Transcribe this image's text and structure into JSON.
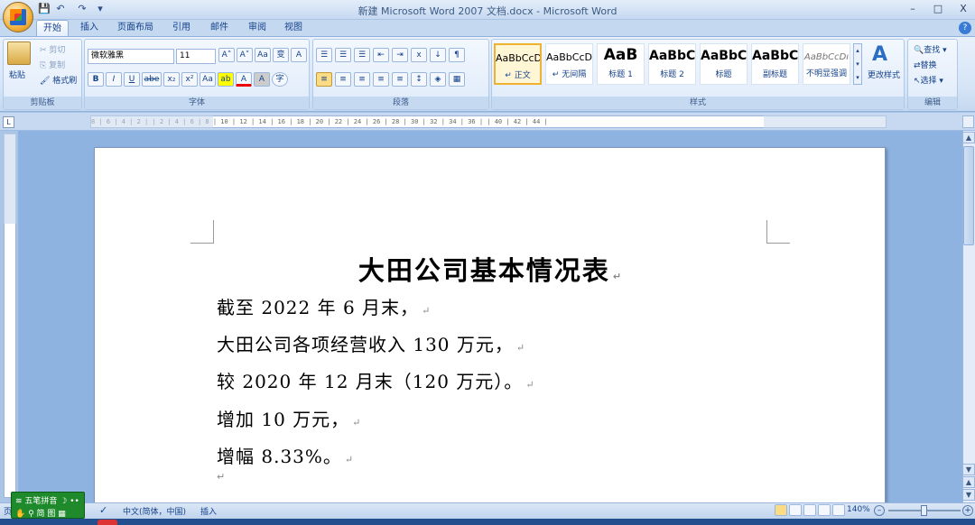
{
  "window": {
    "title": "新建 Microsoft Word 2007 文档.docx - Microsoft Word",
    "minimize": "–",
    "restore": "□",
    "close": "X"
  },
  "qat": {
    "save": "💾",
    "undo": "↶",
    "redo": "↷",
    "more": "▾"
  },
  "tabs": [
    "开始",
    "插入",
    "页面布局",
    "引用",
    "邮件",
    "审阅",
    "视图"
  ],
  "ribbon": {
    "clipboard": {
      "paste": "粘贴",
      "cut": "剪切",
      "copy": "复制",
      "format_painter": "格式刷",
      "label": "剪贴板"
    },
    "font": {
      "name": "微软雅黑",
      "size": "11",
      "label": "字体",
      "btns_row1": [
        "A˄",
        "A˅",
        "Aa",
        "变",
        "A"
      ],
      "btns_row2": [
        "B",
        "I",
        "U",
        "abe",
        "x₂",
        "x²",
        "Aa",
        "ab",
        "A",
        "A",
        "字"
      ]
    },
    "paragraph": {
      "label": "段落",
      "btns_row1": [
        "☰",
        "☰",
        "☰",
        "⇤",
        "⇥",
        "ⅹ",
        "↓",
        "¶"
      ],
      "btns_row2": [
        "≡",
        "≡",
        "≡",
        "≡",
        "≡",
        "↕",
        "◈",
        "▦"
      ]
    },
    "styles": {
      "label": "样式",
      "items": [
        {
          "preview": "AaBbCcD",
          "name": "↵ 正文"
        },
        {
          "preview": "AaBbCcD",
          "name": "↵ 无间隔"
        },
        {
          "preview": "AaB",
          "name": "标题 1"
        },
        {
          "preview": "AaBbC",
          "name": "标题 2"
        },
        {
          "preview": "AaBbC",
          "name": "标题"
        },
        {
          "preview": "AaBbC",
          "name": "副标题"
        },
        {
          "preview": "AaBbCcDı",
          "name": "不明显强调"
        }
      ],
      "change": "更改样式"
    },
    "editing": {
      "find": "查找",
      "replace": "替换",
      "select": "选择",
      "label": "编辑"
    }
  },
  "ruler": {
    "text": "8 | 6 | 4 | 2 |   | 2 | 4 | 6 | 8 | 10 | 12 | 14 | 16 | 18 | 20 | 22 | 24 | 26 | 28 | 30 | 32 | 34 | 36 |   | 40 | 42 | 44 |"
  },
  "document": {
    "title": "大田公司基本情况表",
    "paragraphs": [
      "截至 2022 年 6 月末，",
      "大田公司各项经营收入 130 万元，",
      "较 2020 年 12 月末（120 万元）。",
      "增加 10 万元，",
      "增幅 8.33%。"
    ],
    "para_mark": "↵"
  },
  "status": {
    "language": "中文(简体，中国)",
    "mode": "插入",
    "zoom": "140%",
    "page": "页"
  },
  "ime": {
    "line1": "五笔拼音",
    "line2": "简 图"
  }
}
